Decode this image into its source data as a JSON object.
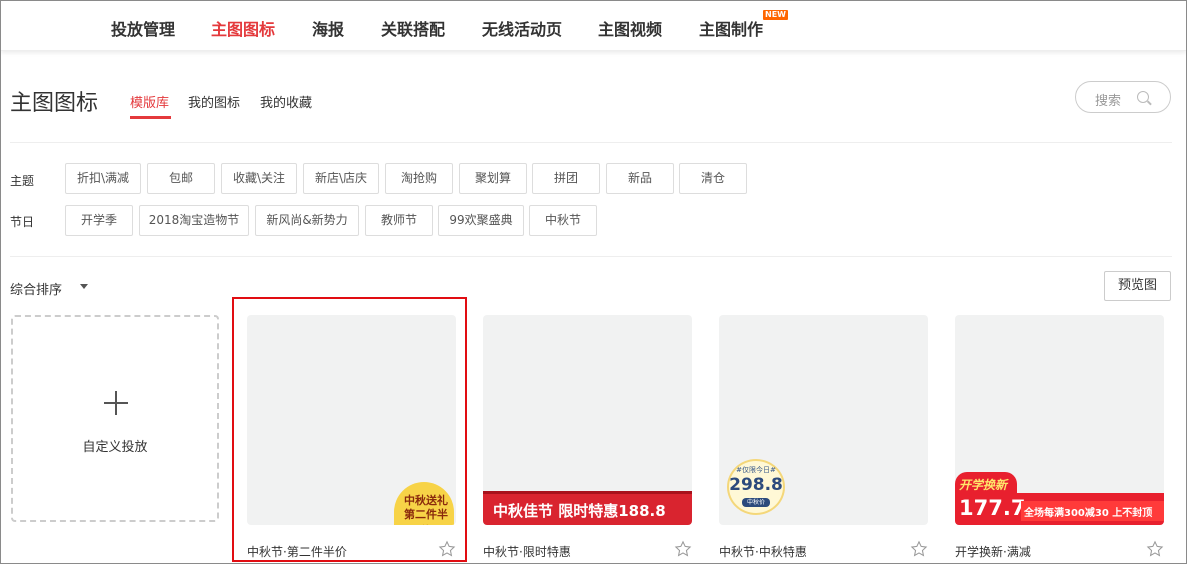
{
  "topnav": {
    "items": [
      "投放管理",
      "主图图标",
      "海报",
      "关联搭配",
      "无线活动页",
      "主图视频",
      "主图制作"
    ],
    "active_index": 1,
    "new_badge": "NEW"
  },
  "header": {
    "title": "主图图标",
    "tabs": [
      "模版库",
      "我的图标",
      "我的收藏"
    ],
    "active_tab": 0,
    "search_placeholder": "搜索"
  },
  "filters": {
    "theme": {
      "label": "主题",
      "chips": [
        "折扣\\满减",
        "包邮",
        "收藏\\关注",
        "新店\\店庆",
        "淘抢购",
        "聚划算",
        "拼团",
        "新品",
        "清仓"
      ]
    },
    "holiday": {
      "label": "节日",
      "chips": [
        "开学季",
        "2018淘宝造物节",
        "新风尚&新势力",
        "教师节",
        "99欢聚盛典",
        "中秋节"
      ]
    }
  },
  "sort": {
    "label": "综合排序"
  },
  "preview_button": "预览图",
  "custom_card": {
    "label": "自定义投放"
  },
  "templates": [
    {
      "title": "中秋节·第二件半价",
      "art_lines": [
        "中秋送礼",
        "第二件半价"
      ],
      "selected": true
    },
    {
      "title": "中秋节·限时特惠",
      "art_lines": [
        "中秋佳节 限时特惠188.8"
      ],
      "selected": false
    },
    {
      "title": "中秋节·中秋特惠",
      "art_lines": [
        "#仅限今日#",
        "298.8",
        "中秋价"
      ],
      "selected": false
    },
    {
      "title": "开学换新·满减",
      "art_lines": [
        "开学换新",
        "177.7",
        "全场每满300减30 上不封顶"
      ],
      "selected": false
    }
  ],
  "colors": {
    "accent": "#e4393c",
    "highlight_border": "#e10d12"
  }
}
